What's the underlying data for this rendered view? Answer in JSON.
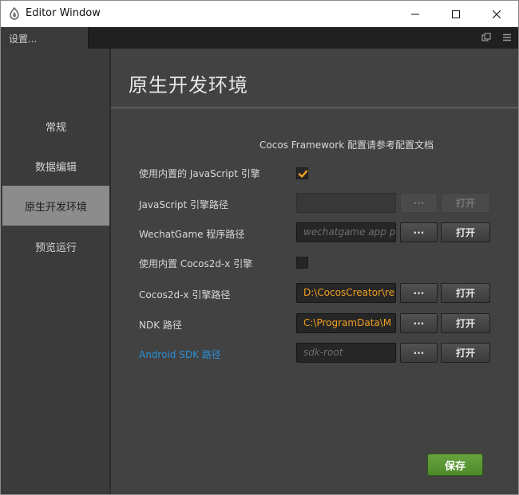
{
  "window": {
    "title": "Editor Window"
  },
  "tab": {
    "label": "设置..."
  },
  "sidebar": {
    "items": [
      {
        "label": "常规"
      },
      {
        "label": "数据编辑"
      },
      {
        "label": "原生开发环境",
        "active": true
      },
      {
        "label": "预览运行"
      }
    ]
  },
  "main": {
    "title": "原生开发环境",
    "hint": "Cocos Framework 配置请参考配置文档",
    "rows": {
      "builtin_js": {
        "label": "使用内置的 JavaScript 引擎",
        "checked": true
      },
      "js_path": {
        "label": "JavaScript 引擎路径",
        "value": "",
        "dots": "···",
        "open": "打开"
      },
      "wechat_path": {
        "label": "WechatGame 程序路径",
        "placeholder": "wechatgame app p",
        "dots": "···",
        "open": "打开"
      },
      "builtin_cocos2dx": {
        "label": "使用内置 Cocos2d-x 引擎",
        "checked": false
      },
      "cocos2dx_path": {
        "label": "Cocos2d-x 引擎路径",
        "value": "D:\\CocosCreator\\re",
        "dots": "···",
        "open": "打开"
      },
      "ndk_path": {
        "label": "NDK 路径",
        "value": "C:\\ProgramData\\M",
        "dots": "···",
        "open": "打开"
      },
      "android_sdk": {
        "label": "Android SDK 路径",
        "placeholder": "sdk-root",
        "dots": "···",
        "open": "打开"
      }
    },
    "save": "保存"
  },
  "colors": {
    "accent_orange": "#f0a020",
    "link_blue": "#2a8fd6",
    "save_green": "#5c9a35"
  }
}
